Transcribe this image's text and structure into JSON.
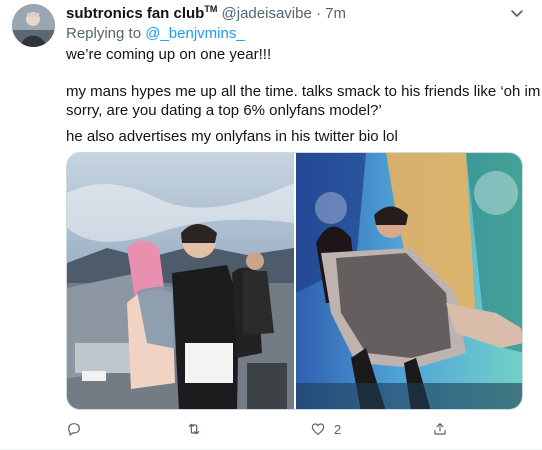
{
  "tweet": {
    "display_name": "subtronics fan club",
    "name_suffix": "TM",
    "handle": "@jadeisavibe",
    "separator": "·",
    "time": "7m",
    "replying_prefix": "Replying to",
    "replying_to": "@_benjvmins_",
    "lines": [
      "we’re coming up on one year!!!",
      "my mans hypes me up all the time. talks smack to his friends like ‘oh im",
      "sorry, are you dating a top 6% onlyfans model?’",
      "he also advertises my onlyfans in his twitter bio lol"
    ],
    "like_count": "2"
  },
  "icons": {
    "avatar": "profile-avatar",
    "caret": "chevron-down-icon",
    "reply": "reply-icon",
    "retweet": "retweet-icon",
    "like": "heart-icon",
    "share": "share-icon"
  },
  "colors": {
    "text": "#0f1419",
    "secondary": "#536471",
    "link": "#1d9bf0",
    "border": "#cfd9de"
  }
}
